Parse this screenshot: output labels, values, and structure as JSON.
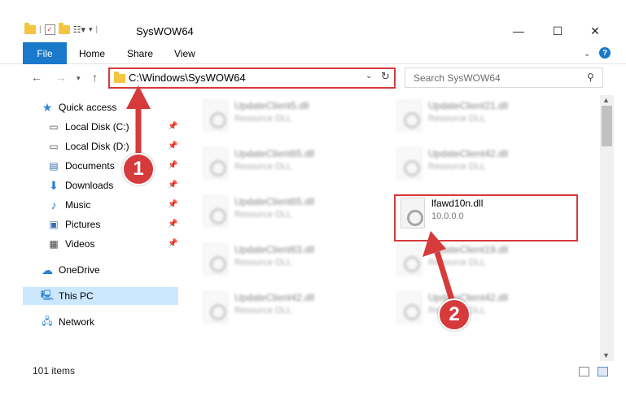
{
  "window": {
    "title": "SysWOW64",
    "minimize": "—",
    "maximize": "☐",
    "close": "✕"
  },
  "ribbon": {
    "file": "File",
    "home": "Home",
    "share": "Share",
    "view": "View",
    "help": "?"
  },
  "address": {
    "path": "C:\\Windows\\SysWOW64"
  },
  "search": {
    "placeholder": "Search SysWOW64"
  },
  "sidebar": {
    "quick_access": "Quick access",
    "items": [
      {
        "label": "Local Disk (C:)"
      },
      {
        "label": "Local Disk (D:)"
      },
      {
        "label": "Documents"
      },
      {
        "label": "Downloads"
      },
      {
        "label": "Music"
      },
      {
        "label": "Pictures"
      },
      {
        "label": "Videos"
      }
    ],
    "onedrive": "OneDrive",
    "this_pc": "This PC",
    "network": "Network"
  },
  "files": {
    "left": [
      {
        "name": "UpdateClient5.dll",
        "sub": "Resource DLL"
      },
      {
        "name": "UpdateClient65.dll",
        "sub": "Resource DLL"
      },
      {
        "name": "UpdateClient65.dll",
        "sub": "Resource DLL"
      },
      {
        "name": "UpdateClient63.dll",
        "sub": "Resource DLL"
      },
      {
        "name": "UpdateClient42.dll",
        "sub": "Resource DLL"
      }
    ],
    "right": [
      {
        "name": "UpdateClient21.dll",
        "sub": "Resource DLL"
      },
      {
        "name": "UpdateClient42.dll",
        "sub": "Resource DLL"
      },
      {
        "name": "lfawd10n.dll",
        "sub": "10.0.0.0"
      },
      {
        "name": "UpdateClient19.dll",
        "sub": "Resource DLL"
      },
      {
        "name": "UpdateClient42.dll",
        "sub": "Resource DLL"
      }
    ]
  },
  "status": {
    "count": "101 items"
  },
  "annotations": {
    "step1": "1",
    "step2": "2",
    "color": "#d63a3a"
  }
}
